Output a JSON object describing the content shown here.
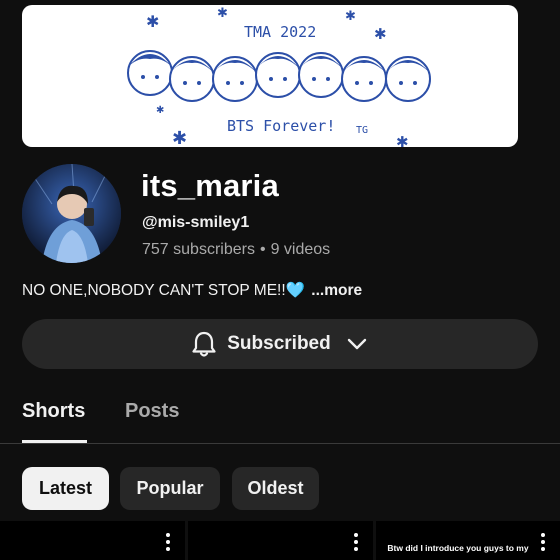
{
  "banner": {
    "title_text": "TMA 2022",
    "caption_text": "BTS Forever!",
    "signature_text": "TG"
  },
  "channel": {
    "name": "its_maria",
    "handle": "@mis-smiley1",
    "subscribers": "757 subscribers",
    "separator": "•",
    "videos": "9 videos",
    "description": "NO ONE,NOBODY CAN'T STOP ME!!",
    "description_emoji": "🩵",
    "more_label": "...more"
  },
  "subscribe_button": {
    "label": "Subscribed",
    "icon": "bell-icon",
    "dropdown_icon": "chevron-down-icon"
  },
  "tabs": [
    {
      "label": "Shorts",
      "active": true
    },
    {
      "label": "Posts",
      "active": false
    }
  ],
  "filters": [
    {
      "label": "Latest",
      "selected": true
    },
    {
      "label": "Popular",
      "selected": false
    },
    {
      "label": "Oldest",
      "selected": false
    }
  ],
  "shorts": [
    {
      "caption": ""
    },
    {
      "caption": ""
    },
    {
      "caption": "Btw did I introduce you guys to my"
    }
  ],
  "colors": {
    "background": "#0f0f0f",
    "surface": "#272727",
    "text_primary": "#f1f1f1",
    "text_secondary": "#aaaaaa",
    "chip_selected": "#f1f1f1",
    "banner_ink": "#2c4fa8"
  }
}
